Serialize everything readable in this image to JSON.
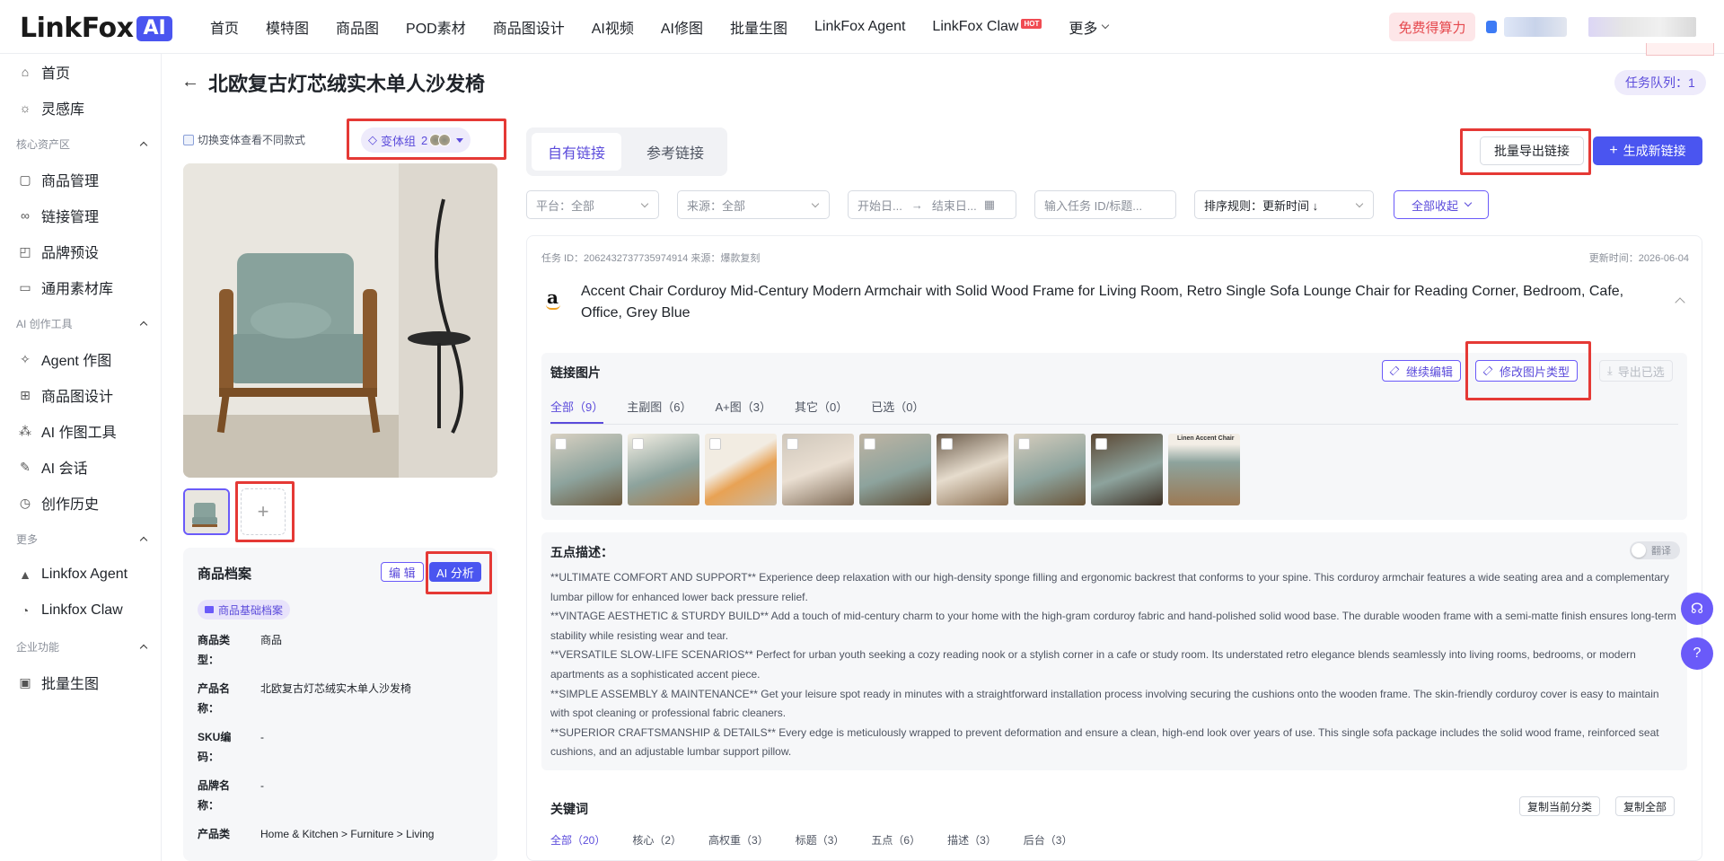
{
  "logo": {
    "text": "LinkFox",
    "badge": "AI"
  },
  "nav": {
    "items": [
      "首页",
      "模特图",
      "商品图",
      "POD素材",
      "商品图设计",
      "AI视频",
      "AI修图",
      "批量生图",
      "LinkFox Agent",
      "LinkFox Claw",
      "更多"
    ],
    "hot_badge": "HOT"
  },
  "header": {
    "free_label": "免费得算力"
  },
  "sidebar": {
    "top": [
      {
        "label": "首页",
        "icon": "home-icon"
      },
      {
        "label": "灵感库",
        "icon": "bulb-icon"
      }
    ],
    "groups": [
      {
        "title": "核心资产区",
        "items": [
          {
            "label": "商品管理",
            "icon": "box-icon"
          },
          {
            "label": "链接管理",
            "icon": "link-icon"
          },
          {
            "label": "品牌预设",
            "icon": "palette-icon"
          },
          {
            "label": "通用素材库",
            "icon": "folder-icon"
          }
        ]
      },
      {
        "title": "AI 创作工具",
        "items": [
          {
            "label": "Agent 作图",
            "icon": "agent-icon"
          },
          {
            "label": "商品图设计",
            "icon": "layout-icon"
          },
          {
            "label": "AI 作图工具",
            "icon": "tools-icon"
          },
          {
            "label": "AI 会话",
            "icon": "chat-icon"
          },
          {
            "label": "创作历史",
            "icon": "history-icon"
          }
        ]
      },
      {
        "title": "更多",
        "items": [
          {
            "label": "Linkfox Agent",
            "icon": "agent-logo-icon"
          },
          {
            "label": "Linkfox Claw",
            "icon": "claw-icon"
          }
        ]
      },
      {
        "title": "企业功能",
        "items": [
          {
            "label": "批量生图",
            "icon": "batch-image-icon"
          }
        ]
      }
    ]
  },
  "page": {
    "title": "北欧复古灯芯绒实木单人沙发椅",
    "task_queue": "任务队列：1"
  },
  "product": {
    "switch_hint": "切换变体查看不同款式",
    "variant_label": "变体组",
    "variant_count": "2",
    "add_symbol": "+",
    "profile": {
      "title": "商品档案",
      "edit_label": "编 辑",
      "ai_label": "AI 分析",
      "base_tag": "商品基础档案",
      "fields": [
        {
          "label": "商品类型：",
          "value": "商品"
        },
        {
          "label": "产品名称：",
          "value": "北欧复古灯芯绒实木单人沙发椅"
        },
        {
          "label": "SKU编码：",
          "value": "-"
        },
        {
          "label": "品牌名称：",
          "value": "-"
        },
        {
          "label": "产品类",
          "value": "Home & Kitchen > Furniture > Living"
        }
      ]
    }
  },
  "links": {
    "tabs": [
      "自有链接",
      "参考链接"
    ],
    "export_label": "批量导出链接",
    "generate_label": "生成新链接",
    "filters": {
      "platform_label": "平台：",
      "platform_value": "全部",
      "source_label": "来源：",
      "source_value": "全部",
      "start_placeholder": "开始日...",
      "end_placeholder": "结束日...",
      "search_placeholder": "输入任务 ID/标题...",
      "sort_label": "排序规则：",
      "sort_value": "更新时间 ↓",
      "collapse_label": "全部收起"
    },
    "task": {
      "meta": "任务 ID：2062432737735974914   来源：爆款复刻",
      "update_time": "更新时间：2026-06-04",
      "title": "Accent Chair Corduroy Mid-Century Modern Armchair with Solid Wood Frame for Living Room, Retro Single Sofa Lounge Chair for Reading Corner, Bedroom, Cafe, Office, Grey Blue",
      "images": {
        "title": "链接图片",
        "continue_edit": "继续编辑",
        "modify_type": "修改图片类型",
        "export_selected": "导出已选",
        "tabs": [
          "全部（9）",
          "主副图（6）",
          "A+图（3）",
          "其它（0）",
          "已选（0）"
        ],
        "thumb_caption": "Linen Accent Chair"
      },
      "five_points": {
        "title": "五点描述：",
        "translate": "翻译",
        "bullets": [
          "**ULTIMATE COMFORT AND SUPPORT** Experience deep relaxation with our high-density sponge filling and ergonomic backrest that conforms to your spine. This corduroy armchair features a wide seating area and a complementary lumbar pillow for enhanced lower back pressure relief.",
          "**VINTAGE AESTHETIC & STURDY BUILD** Add a touch of mid-century charm to your home with the high-gram corduroy fabric and hand-polished solid wood base. The durable wooden frame with a semi-matte finish ensures long-term stability while resisting wear and tear.",
          "**VERSATILE SLOW-LIFE SCENARIOS** Perfect for urban youth seeking a cozy reading nook or a stylish corner in a cafe or study room. Its understated retro elegance blends seamlessly into living rooms, bedrooms, or modern apartments as a sophisticated accent piece.",
          "**SIMPLE ASSEMBLY & MAINTENANCE** Get your leisure spot ready in minutes with a straightforward installation process involving securing the cushions onto the wooden frame. The skin-friendly corduroy cover is easy to maintain with spot cleaning or professional fabric cleaners.",
          "**SUPERIOR CRAFTSMANSHIP & DETAILS** Every edge is meticulously wrapped to prevent deformation and ensure a clean, high-end look over years of use. This single sofa package includes the solid wood frame, reinforced seat cushions, and an adjustable lumbar support pillow."
        ]
      },
      "keywords": {
        "title": "关键词",
        "copy_category": "复制当前分类",
        "copy_all": "复制全部",
        "tabs": [
          "全部（20）",
          "核心（2）",
          "高权重（3）",
          "标题（3）",
          "五点（6）",
          "描述（3）",
          "后台（3）"
        ]
      }
    }
  },
  "colors": {
    "accent": "#4a55f0",
    "purple": "#6a5af9",
    "highlight_red": "#e53935"
  }
}
